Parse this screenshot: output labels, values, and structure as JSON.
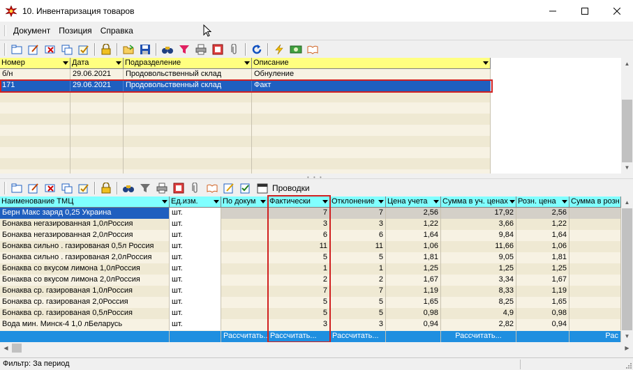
{
  "window": {
    "title": "10. Инвентаризация товаров"
  },
  "menu": [
    "Документ",
    "Позиция",
    "Справка"
  ],
  "docs": {
    "columns": [
      "Номер",
      "Дата",
      "Подразделение",
      "Описание"
    ],
    "rows": [
      {
        "num": "б/н",
        "date": "29.06.2021",
        "dept": "Продовольственный склад",
        "desc": "Обнуление"
      },
      {
        "num": "171",
        "date": "29.06.2021",
        "dept": "Продовольственный склад",
        "desc": "Факт"
      }
    ]
  },
  "items": {
    "toolbar_label": "Проводки",
    "columns": [
      "Наименование ТМЦ",
      "Ед.изм.",
      "По докум",
      "Фактически",
      "Отклонение",
      "Цена учета",
      "Сумма в уч. ценах",
      "Розн. цена",
      "Сумма в розн"
    ],
    "rows": [
      {
        "name": "Берн Макс заряд 0,25 Украина",
        "unit": "шт.",
        "doc": "",
        "fact": "7",
        "dev": "7",
        "price": "2,56",
        "sum": "17,92",
        "retail": "2,56"
      },
      {
        "name": "Бонаква  негазированная 1,0лРоссия",
        "unit": "шт.",
        "doc": "",
        "fact": "3",
        "dev": "3",
        "price": "1,22",
        "sum": "3,66",
        "retail": "1,22"
      },
      {
        "name": "Бонаква  негазированная 2,0лРоссия",
        "unit": "шт.",
        "doc": "",
        "fact": "6",
        "dev": "6",
        "price": "1,64",
        "sum": "9,84",
        "retail": "1,64"
      },
      {
        "name": "Бонаква  сильно . газированая 0,5л Россия",
        "unit": "шт.",
        "doc": "",
        "fact": "11",
        "dev": "11",
        "price": "1,06",
        "sum": "11,66",
        "retail": "1,06"
      },
      {
        "name": "Бонаква  сильно . газированая 2,0лРоссия",
        "unit": "шт.",
        "doc": "",
        "fact": "5",
        "dev": "5",
        "price": "1,81",
        "sum": "9,05",
        "retail": "1,81"
      },
      {
        "name": "Бонаква  со вкусом лимона  1,0лРоссия",
        "unit": "шт.",
        "doc": "",
        "fact": "1",
        "dev": "1",
        "price": "1,25",
        "sum": "1,25",
        "retail": "1,25"
      },
      {
        "name": "Бонаква  со вкусом лимона  2,0лРоссия",
        "unit": "шт.",
        "doc": "",
        "fact": "2",
        "dev": "2",
        "price": "1,67",
        "sum": "3,34",
        "retail": "1,67"
      },
      {
        "name": "Бонаква  ср. газированая  1,0лРоссия",
        "unit": "шт.",
        "doc": "",
        "fact": "7",
        "dev": "7",
        "price": "1,19",
        "sum": "8,33",
        "retail": "1,19"
      },
      {
        "name": "Бонаква  ср. газированая  2,0Россия",
        "unit": "шт.",
        "doc": "",
        "fact": "5",
        "dev": "5",
        "price": "1,65",
        "sum": "8,25",
        "retail": "1,65"
      },
      {
        "name": "Бонаква  ср. газированая 0,5лРоссия",
        "unit": "шт.",
        "doc": "",
        "fact": "5",
        "dev": "5",
        "price": "0,98",
        "sum": "4,9",
        "retail": "0,98"
      },
      {
        "name": "Вода мин. Минск-4   1,0 лБеларусь",
        "unit": "шт.",
        "doc": "",
        "fact": "3",
        "dev": "3",
        "price": "0,94",
        "sum": "2,82",
        "retail": "0,94"
      }
    ],
    "footer": {
      "doc": "Рассчитать...",
      "fact": "Рассчитать...",
      "dev": "Рассчитать...",
      "sum": "Рассчитать...",
      "retail_sum": "Рас"
    }
  },
  "status": {
    "filter": "Фильтр: За период"
  },
  "colors": {
    "header_docs": "#ffff80",
    "header_items": "#80ffff",
    "selected": "#1f5fbf",
    "grid_bg": "#f7f2e3",
    "highlight": "#d02020"
  }
}
